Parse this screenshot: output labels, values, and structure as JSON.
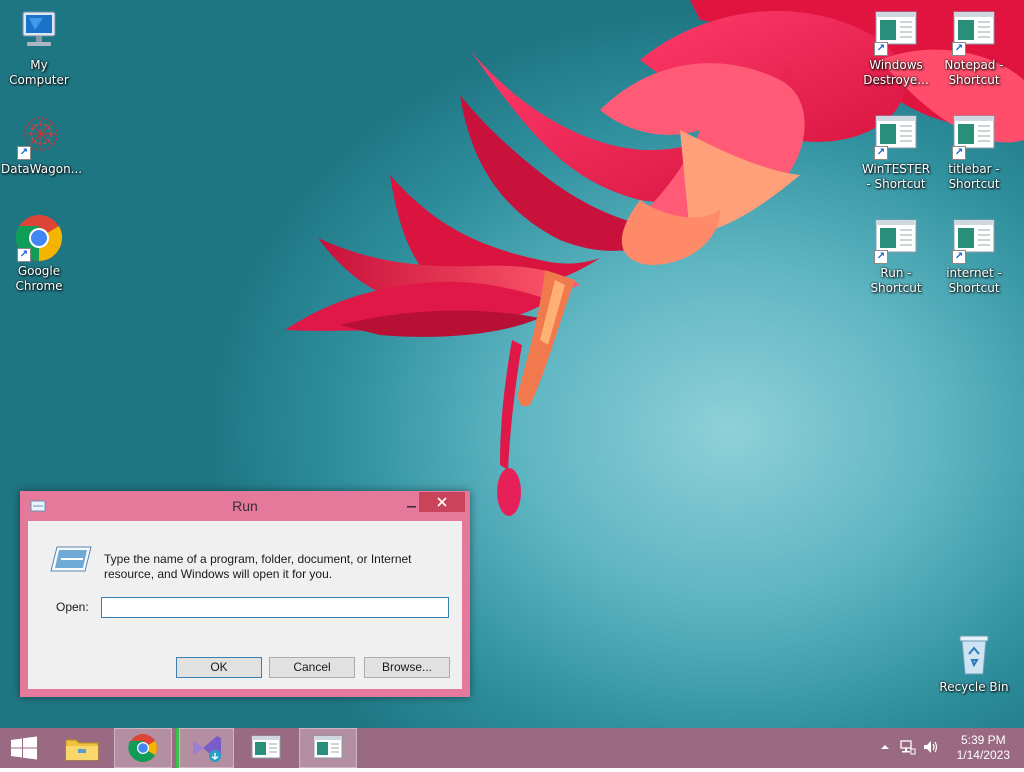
{
  "desktop": {
    "icons_left": [
      {
        "label": "My Computer",
        "icon": "computer-icon"
      },
      {
        "label": "DataWagon...",
        "icon": "datawagon-icon"
      },
      {
        "label": "Google Chrome",
        "icon": "chrome-icon"
      }
    ],
    "icons_right": [
      {
        "label": "Windows Destroye...",
        "icon": "app-window-icon"
      },
      {
        "label": "Notepad - Shortcut",
        "icon": "app-window-icon"
      },
      {
        "label": "WinTESTER - Shortcut",
        "icon": "app-window-icon"
      },
      {
        "label": "titlebar - Shortcut",
        "icon": "app-window-icon"
      },
      {
        "label": "Run - Shortcut",
        "icon": "app-window-icon"
      },
      {
        "label": "internet - Shortcut",
        "icon": "app-window-icon"
      }
    ],
    "recycle_bin": {
      "label": "Recycle Bin",
      "icon": "recycle-bin-icon"
    }
  },
  "run_dialog": {
    "title": "Run",
    "message": "Type the name of a program, folder, document, or Internet resource, and Windows will open it for you.",
    "open_label": "Open:",
    "open_value": "",
    "buttons": {
      "ok": "OK",
      "cancel": "Cancel",
      "browse": "Browse..."
    },
    "accent_color": "#e5799c"
  },
  "taskbar": {
    "color": "#9a6a82",
    "items": [
      {
        "name": "start-button",
        "icon": "windows-logo-icon"
      },
      {
        "name": "file-explorer",
        "icon": "folder-icon"
      },
      {
        "name": "chrome",
        "icon": "chrome-icon"
      },
      {
        "name": "visual-studio",
        "icon": "visual-studio-icon"
      },
      {
        "name": "app-window",
        "icon": "app-window-icon"
      },
      {
        "name": "app-window-active",
        "icon": "app-window-icon"
      }
    ],
    "clock": {
      "time": "5:39 PM",
      "date": "1/14/2023"
    }
  }
}
